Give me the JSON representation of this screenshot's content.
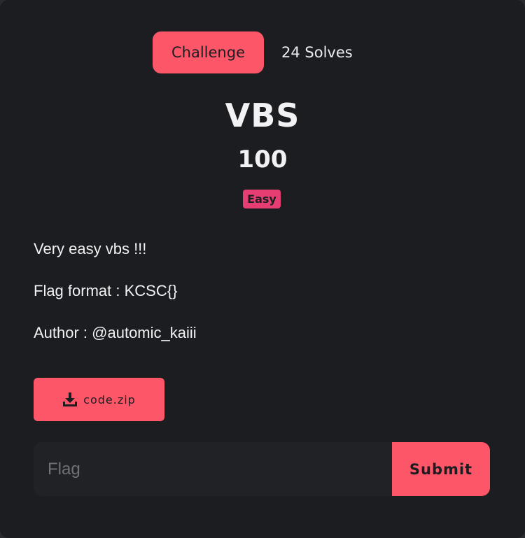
{
  "tabs": {
    "challenge_label": "Challenge",
    "solves_label": "24 Solves"
  },
  "challenge": {
    "name": "VBS",
    "points": "100",
    "difficulty": "Easy",
    "description": [
      "Very easy vbs !!!",
      "Flag format : KCSC{}",
      "Author : @automic_kaiii"
    ]
  },
  "files": [
    {
      "name": "code.zip",
      "icon": "download-icon"
    }
  ],
  "flag_form": {
    "placeholder": "Flag",
    "value": "",
    "submit_label": "Submit"
  },
  "colors": {
    "accent": "#fe5669",
    "badge": "#e63e72",
    "background": "#1c1d21",
    "input_bg": "#212225",
    "text": "#f2f2f4"
  }
}
